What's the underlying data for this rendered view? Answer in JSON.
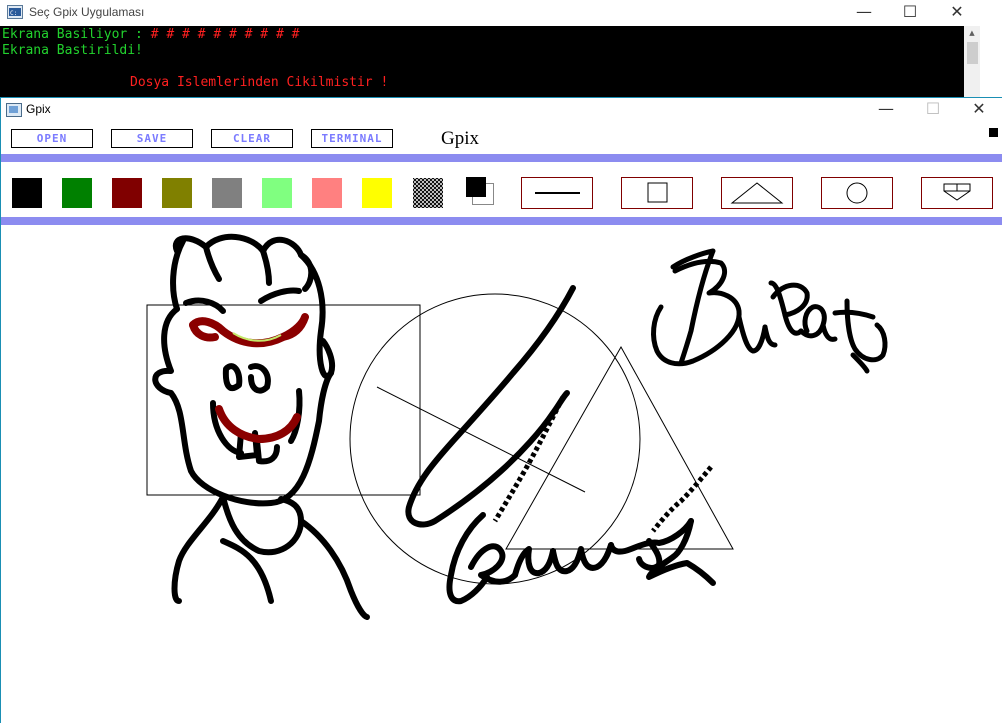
{
  "console": {
    "title": "Seç Gpix Uygulaması",
    "line1_label": "Ekrana Basiliyor : ",
    "line1_marks": "# # # # # # # # # #",
    "line2": "Ekrana Bastirildi!",
    "line3": "Dosya Islemlerinden Cikilmistir !"
  },
  "gpix": {
    "title": "Gpix",
    "app_name": "Gpix",
    "menu": {
      "open": "OPEN",
      "save": "SAVE",
      "clear": "CLEAR",
      "terminal": "TERMINAL"
    },
    "palette": [
      {
        "name": "black",
        "color": "#000000"
      },
      {
        "name": "green",
        "color": "#008000"
      },
      {
        "name": "maroon",
        "color": "#800000"
      },
      {
        "name": "olive",
        "color": "#808000"
      },
      {
        "name": "gray",
        "color": "#808080"
      },
      {
        "name": "light-green",
        "color": "#80ff80"
      },
      {
        "name": "salmon",
        "color": "#ff8080"
      },
      {
        "name": "yellow",
        "color": "#ffff00"
      }
    ],
    "tools": [
      "line",
      "rectangle",
      "triangle",
      "circle",
      "fill"
    ],
    "canvas_text": "Burak"
  },
  "colors": {
    "accent_bar": "#8c8cf0",
    "button_text": "#7b7bff",
    "tool_border": "#800000",
    "console_green": "#22d32e",
    "console_red": "#ff2020"
  }
}
